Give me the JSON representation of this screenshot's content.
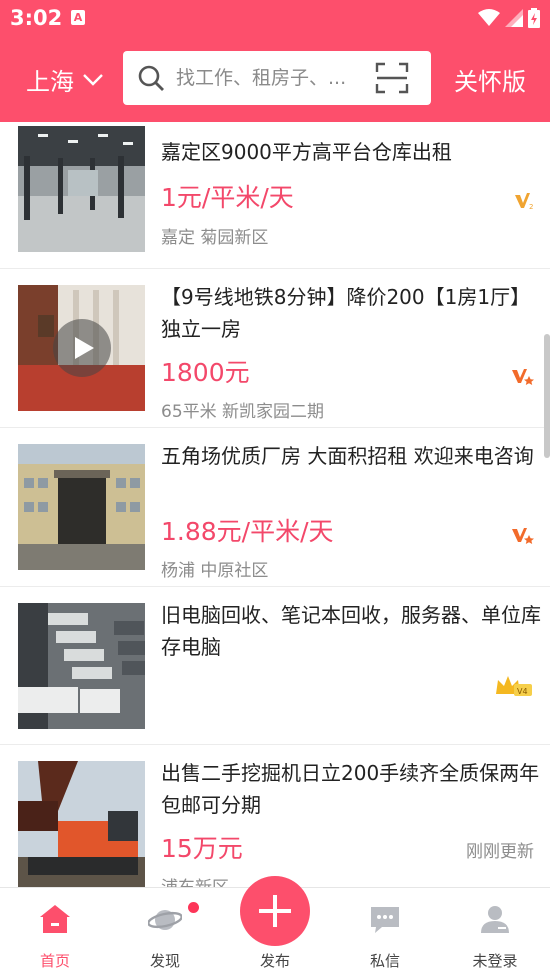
{
  "status_bar": {
    "time": "3:02",
    "notification_glyph": "A"
  },
  "header": {
    "city": "上海",
    "search_placeholder": "找工作、租房子、...",
    "care_mode": "关怀版"
  },
  "listings": [
    {
      "title": "嘉定区9000平方高平台仓库出租",
      "price": "1元/平米/天",
      "meta": "嘉定 菊园新区",
      "badge": "v2-badge",
      "thumb": "warehouse-photo"
    },
    {
      "title": "【9号线地铁8分钟】降价200【1房1厅】独立一房",
      "price": "1800元",
      "meta": "65平米 新凯家园二期",
      "badge": "v-star-badge",
      "thumb": "bedroom-photo",
      "has_video": true
    },
    {
      "title": "五角场优质厂房 大面积招租 欢迎来电咨询",
      "price": "1.88元/平米/天",
      "meta": "杨浦 中原社区",
      "badge": "v-star-badge",
      "thumb": "factory-photo"
    },
    {
      "title": "旧电脑回收、笔记本回收，服务器、单位库存电脑",
      "price": "",
      "meta": "",
      "badge": "crown-v4-badge",
      "thumb": "laptops-photo"
    },
    {
      "title": "出售二手挖掘机日立200手续齐全质保两年包邮可分期",
      "price": "15万元",
      "meta": "浦东新区",
      "updated": "刚刚更新",
      "thumb": "excavator-photo"
    }
  ],
  "bottom_nav": [
    {
      "label": "首页",
      "icon": "home-icon",
      "active": true
    },
    {
      "label": "发现",
      "icon": "planet-icon",
      "has_dot": true
    },
    {
      "label": "发布",
      "icon": "plus-icon"
    },
    {
      "label": "私信",
      "icon": "chat-icon"
    },
    {
      "label": "未登录",
      "icon": "user-icon"
    }
  ],
  "colors": {
    "brand": "#fd4f6c",
    "price": "#f3486a",
    "meta": "#8c8c8c"
  }
}
